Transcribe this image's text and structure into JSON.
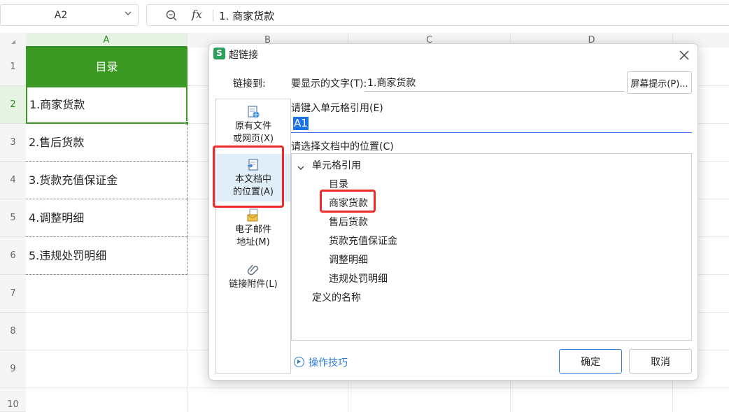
{
  "formula_bar": {
    "name_box": "A2",
    "fx_label": "fx",
    "content": "1. 商家货款"
  },
  "columns": [
    "A",
    "B",
    "C",
    "D"
  ],
  "rows": [
    "1",
    "2",
    "3",
    "4",
    "5",
    "6",
    "7",
    "8",
    "9",
    "10"
  ],
  "cells": {
    "header": "目录",
    "items": [
      "1.商家货款",
      "2.售后货款",
      "3.货款充值保证金",
      "4.调整明细",
      "5.违规处罚明细"
    ]
  },
  "colors": {
    "header_fill": "#3c9a24",
    "selection": "#3c9a24",
    "highlight_box": "#f02a2a",
    "link": "#2e7bd6"
  },
  "dialog": {
    "logo": "S",
    "title": "超链接",
    "link_to_label": "链接到:",
    "display_text_label": "要显示的文字(T):",
    "display_text_value": "1.商家货款",
    "screen_tip_button": "屏幕提示(P)...",
    "nav": [
      {
        "line1": "原有文件",
        "line2": "或网页(X)",
        "icon": "file-web-icon"
      },
      {
        "line1": "本文档中",
        "line2": "的位置(A)",
        "icon": "document-place-icon"
      },
      {
        "line1": "电子邮件",
        "line2": "地址(M)",
        "icon": "email-icon"
      },
      {
        "line1": "链接附件(L)",
        "line2": "",
        "icon": "paperclip-icon"
      }
    ],
    "cell_ref_label": "请键入单元格引用(E)",
    "cell_ref_value": "A1",
    "location_label": "请选择文档中的位置(C)",
    "tree": {
      "group1": "单元格引用",
      "children": [
        "目录",
        "商家货款",
        "售后货款",
        "货款充值保证金",
        "调整明细",
        "违规处罚明细"
      ],
      "group2": "定义的名称"
    },
    "help_link": "操作技巧",
    "ok_button": "确定",
    "cancel_button": "取消"
  }
}
